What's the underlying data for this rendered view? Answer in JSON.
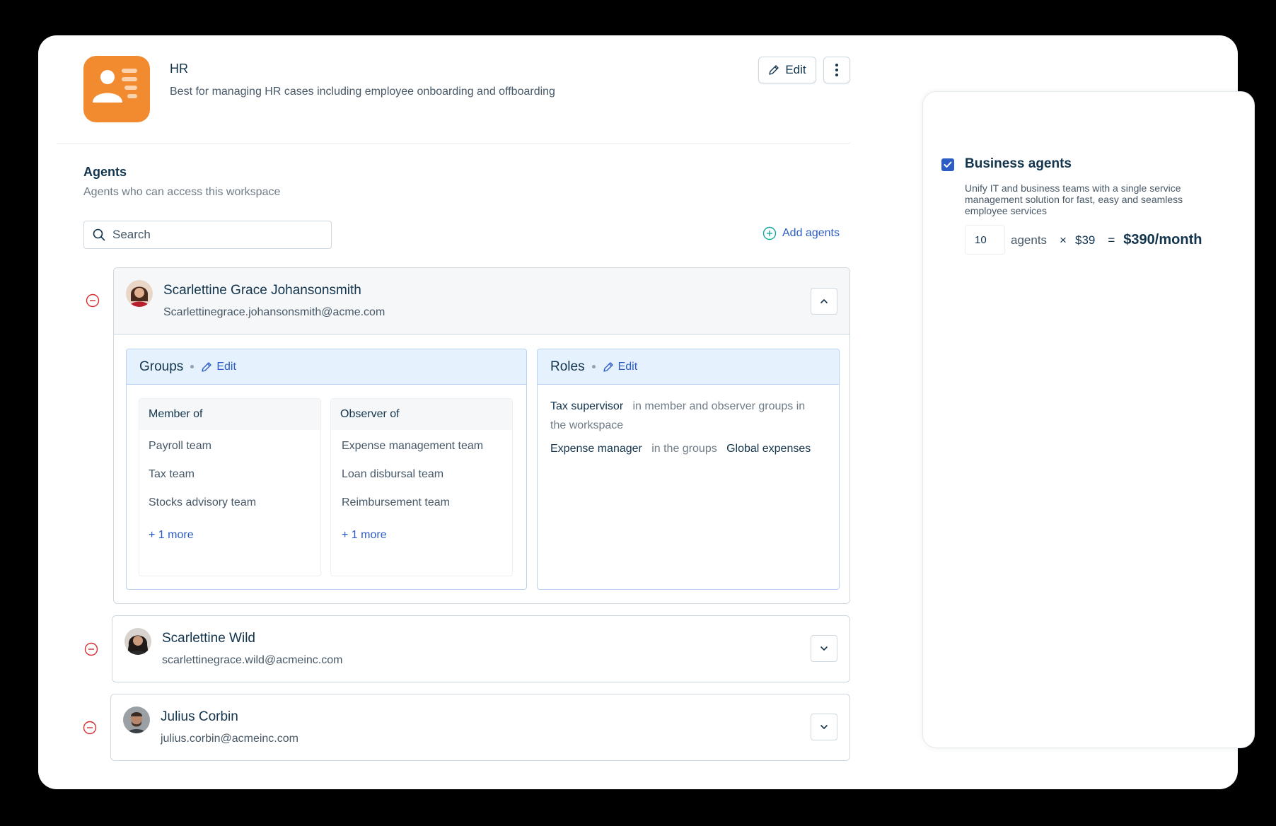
{
  "workspace": {
    "title": "HR",
    "description": "Best for managing HR cases including employee onboarding and offboarding",
    "edit_label": "Edit",
    "accent_color": "#f28a30"
  },
  "agents_section": {
    "title": "Agents",
    "subtitle": "Agents who can access this workspace",
    "search_placeholder": "Search",
    "add_label": "Add agents"
  },
  "agents": [
    {
      "name": "Scarlettine Grace Johansonsmith",
      "email": "Scarlettinegrace.johansonsmith@acme.com"
    },
    {
      "name": "Scarlettine Wild",
      "email": "scarlettinegrace.wild@acmeinc.com"
    },
    {
      "name": "Julius Corbin",
      "email": "julius.corbin@acmeinc.com"
    }
  ],
  "groups": {
    "title": "Groups",
    "edit_label": "Edit",
    "member_of": {
      "header": "Member of",
      "items": [
        "Payroll team",
        "Tax team",
        "Stocks advisory team"
      ],
      "more": "+ 1 more"
    },
    "observer_of": {
      "header": "Observer of",
      "items": [
        "Expense management team",
        "Loan disbursal team",
        "Reimbursement team"
      ],
      "more": "+ 1 more"
    }
  },
  "roles": {
    "title": "Roles",
    "edit_label": "Edit",
    "lines": [
      {
        "role": "Tax supervisor",
        "scope": "in member and observer groups in the workspace"
      },
      {
        "role": "Expense manager",
        "scope": "in the groups",
        "target": "Global expenses"
      }
    ]
  },
  "plan": {
    "title": "Business agents",
    "checked": true,
    "description": "Unify IT and business teams with a single service management solution for fast, easy and seamless employee services",
    "quantity": "10",
    "unit_label": "agents",
    "multiply": "×",
    "price": "$39",
    "equals": "=",
    "total": "$390/month"
  }
}
